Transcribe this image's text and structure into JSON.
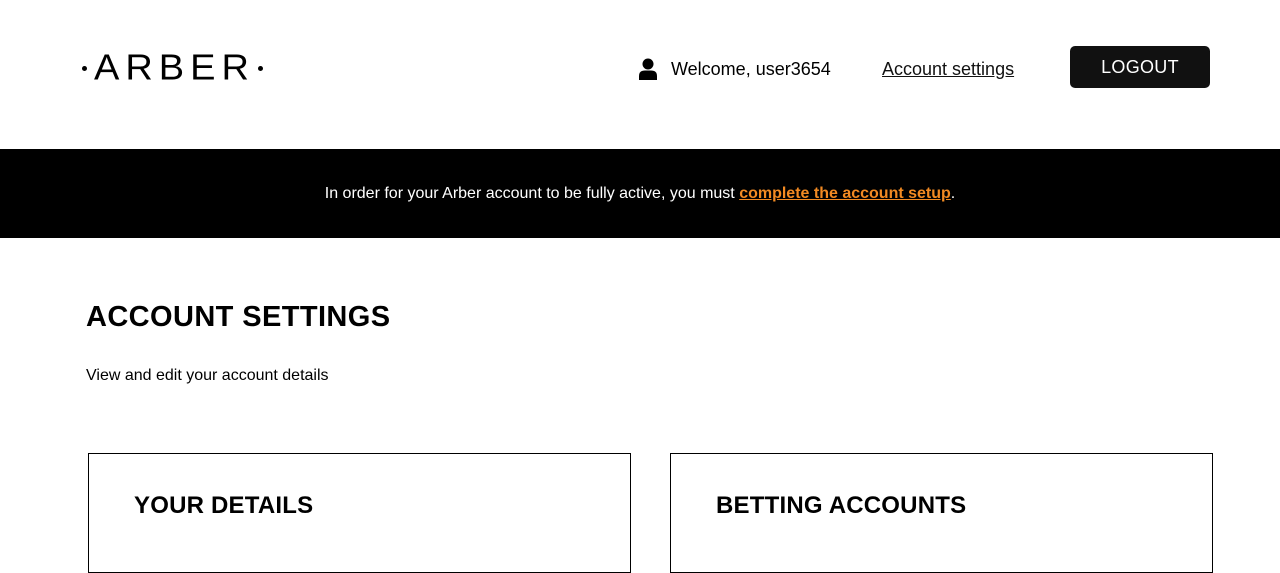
{
  "header": {
    "logo_text": "ARBER",
    "welcome_text": "Welcome, user3654",
    "account_settings_link": "Account settings",
    "logout_label": "LOGOUT"
  },
  "banner": {
    "text_before": "In order for your Arber account to be fully active, you must ",
    "link_text": "complete the account setup",
    "text_after": ".",
    "link_color": "#f28a22",
    "background": "#000000"
  },
  "main": {
    "title": "ACCOUNT SETTINGS",
    "subtitle": "View and edit your account details",
    "cards": [
      {
        "title": "YOUR DETAILS"
      },
      {
        "title": "BETTING ACCOUNTS"
      }
    ]
  },
  "icons": {
    "user": "user-icon"
  }
}
